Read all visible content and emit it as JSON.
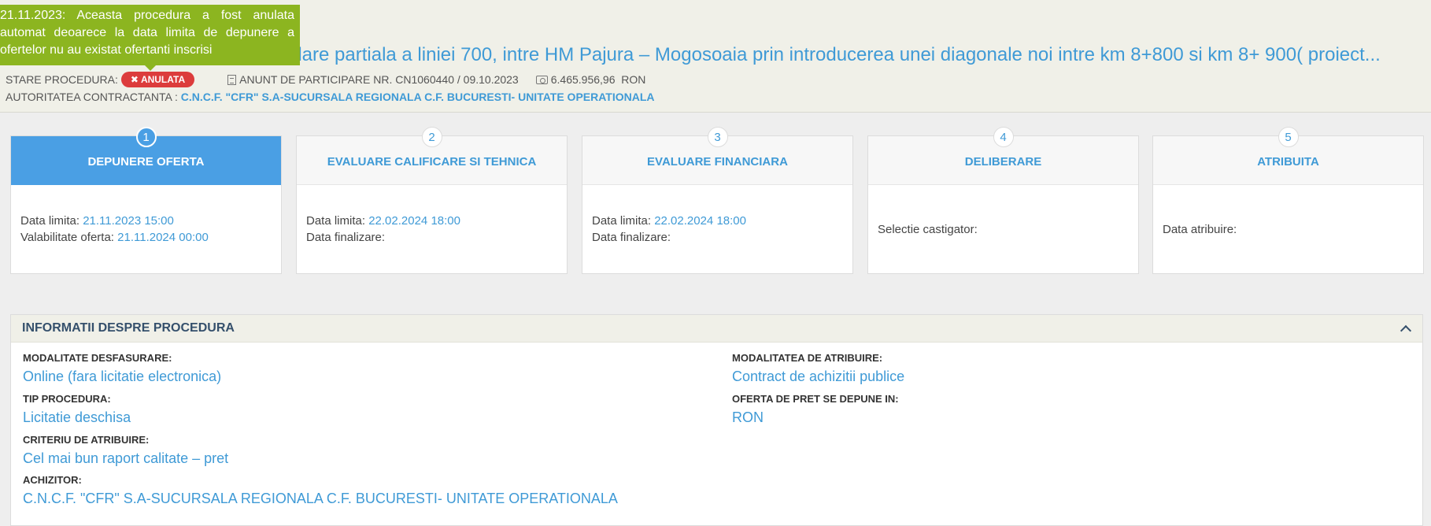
{
  "tooltip": {
    "text": "21.11.2023: Aceasta procedura a fost anulata automat deoarece la data limita de depunere a ofertelor nu au existat ofertanti inscrisi"
  },
  "header": {
    "title": "olare partiala a liniei 700, intre HM Pajura – Mogosoaia prin introducerea unei diagonale noi intre km 8+800 si km 8+ 900( proiect...",
    "stare_label": "STARE PROCEDURA:",
    "status_badge": "ANULATA",
    "anunt": "ANUNT DE PARTICIPARE NR. CN1060440 / 09.10.2023",
    "valoare": "6.465.956,96  RON",
    "autoritate_label": "AUTORITATEA CONTRACTANTA :",
    "autoritate_value": "C.N.C.F. \"CFR\" S.A-SUCURSALA REGIONALA C.F. BUCURESTI- UNITATE OPERATIONALA"
  },
  "steps": [
    {
      "num": "1",
      "title": "DEPUNERE OFERTA",
      "rows": [
        {
          "label": "Data limita: ",
          "value": "21.11.2023 15:00"
        },
        {
          "label": "Valabilitate oferta: ",
          "value": "21.11.2024 00:00"
        }
      ]
    },
    {
      "num": "2",
      "title": "EVALUARE CALIFICARE SI TEHNICA",
      "rows": [
        {
          "label": "Data limita: ",
          "value": "22.02.2024 18:00"
        },
        {
          "label": "Data finalizare:",
          "value": ""
        }
      ]
    },
    {
      "num": "3",
      "title": "EVALUARE FINANCIARA",
      "rows": [
        {
          "label": "Data limita: ",
          "value": "22.02.2024 18:00"
        },
        {
          "label": "Data finalizare:",
          "value": ""
        }
      ]
    },
    {
      "num": "4",
      "title": "DELIBERARE",
      "rows": [
        {
          "label": "Selectie castigator:",
          "value": ""
        }
      ]
    },
    {
      "num": "5",
      "title": "ATRIBUITA",
      "rows": [
        {
          "label": "Data atribuire:",
          "value": ""
        }
      ]
    }
  ],
  "panel": {
    "title": "INFORMATII DESPRE PROCEDURA",
    "fields": {
      "modalitate_desfasurare": {
        "label": "MODALITATE DESFASURARE:",
        "value": "Online (fara licitatie electronica)"
      },
      "tip_procedura": {
        "label": "TIP PROCEDURA:",
        "value": "Licitatie deschisa"
      },
      "criteriu": {
        "label": "CRITERIU DE ATRIBUIRE:",
        "value": "Cel mai bun raport calitate – pret"
      },
      "achizitor": {
        "label": "ACHIZITOR:",
        "value": "C.N.C.F. \"CFR\" S.A-SUCURSALA REGIONALA C.F. BUCURESTI- UNITATE OPERATIONALA"
      },
      "modalitate_atribuire": {
        "label": "MODALITATEA DE ATRIBUIRE:",
        "value": "Contract de achizitii publice"
      },
      "oferta_pret": {
        "label": "OFERTA DE PRET SE DEPUNE IN:",
        "value": "RON"
      }
    }
  }
}
